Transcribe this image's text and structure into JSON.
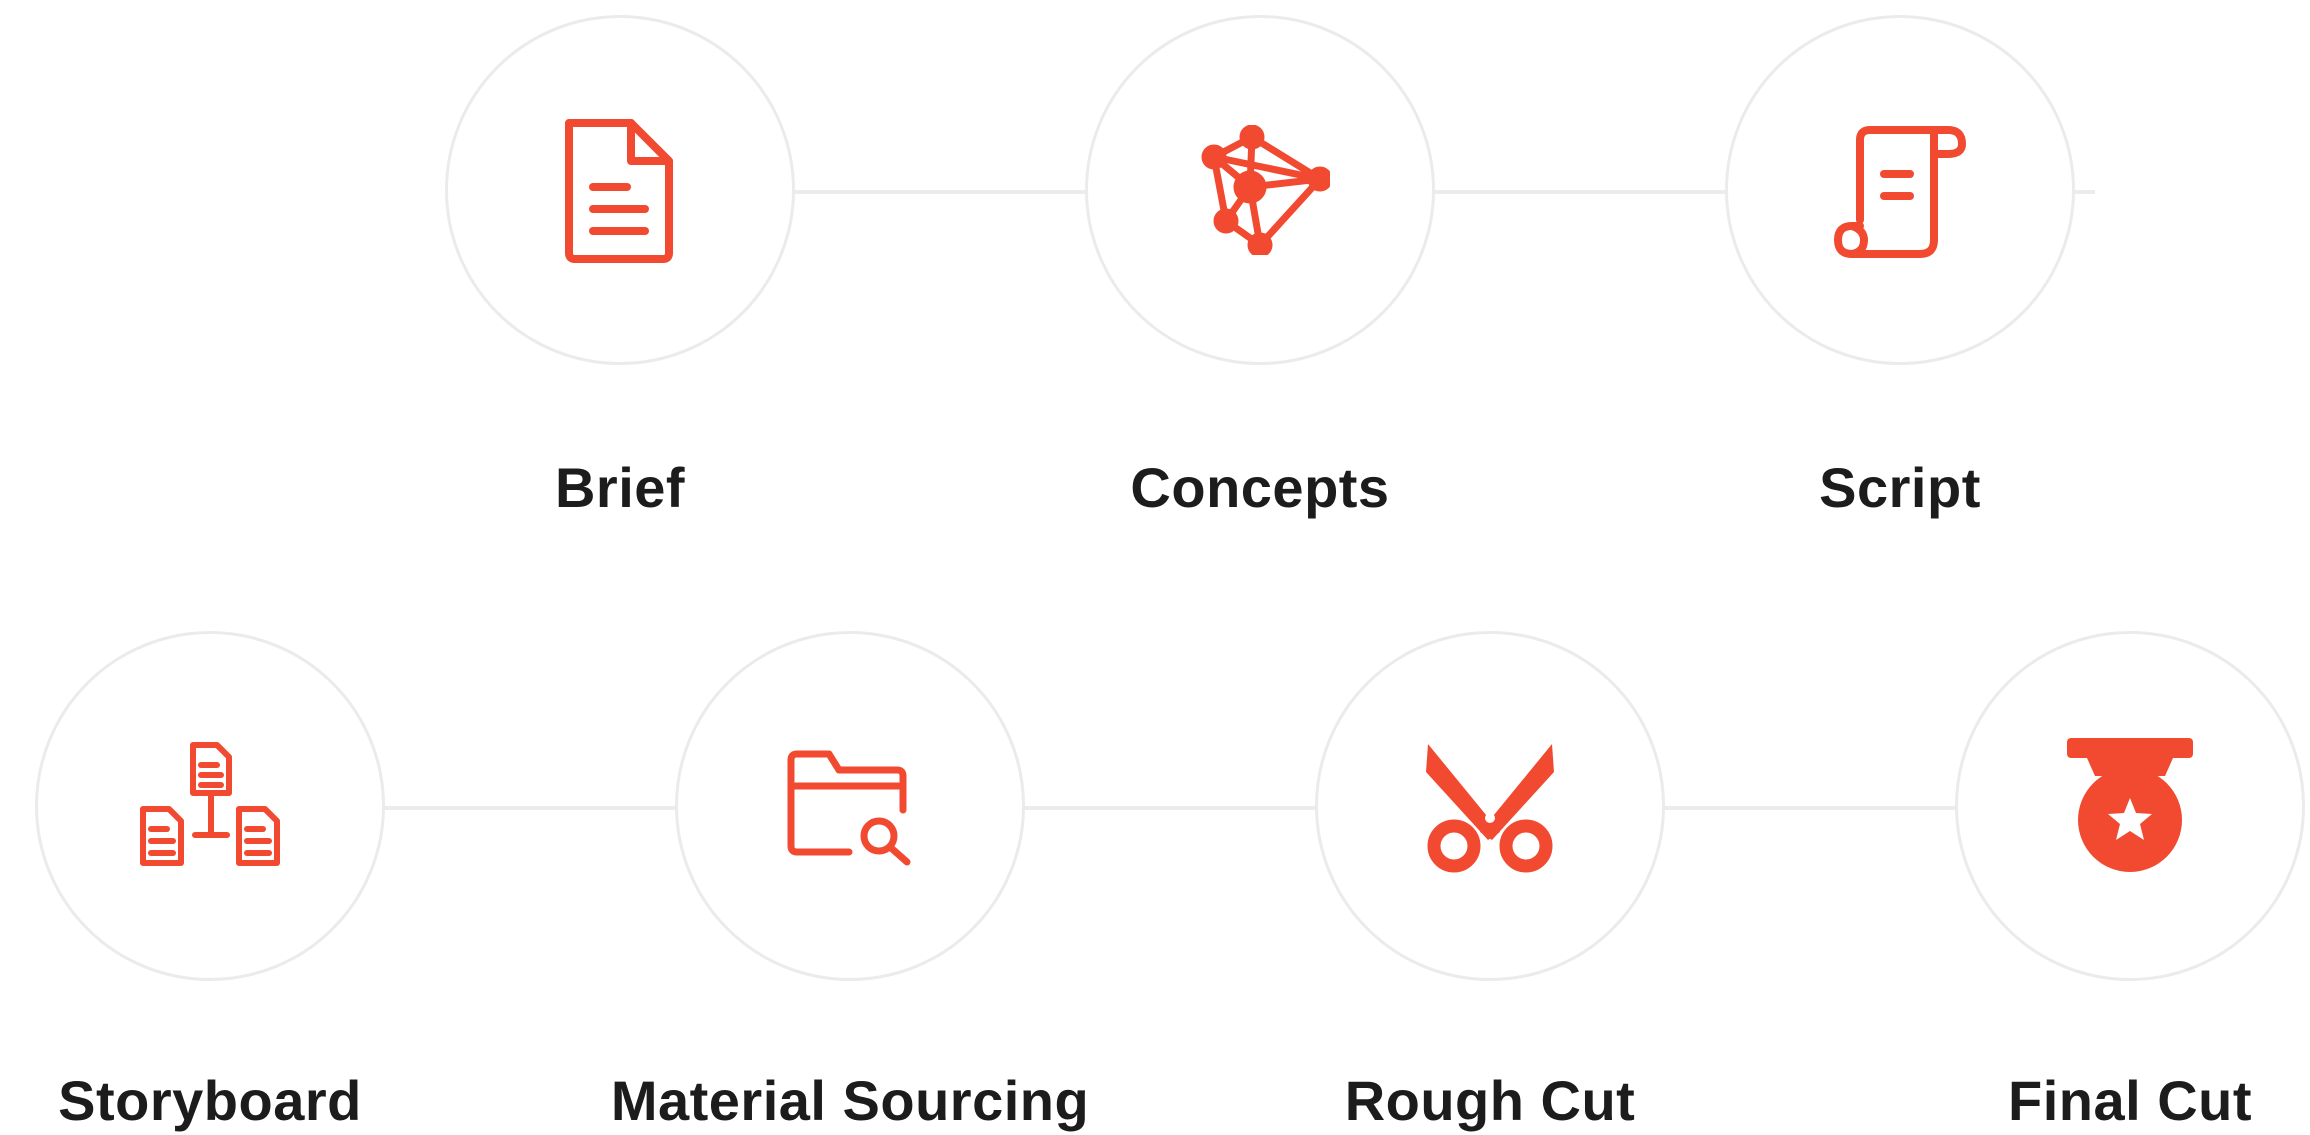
{
  "accent_color": "#f24a30",
  "steps": [
    {
      "label": "Brief",
      "icon": "document-icon"
    },
    {
      "label": "Concepts",
      "icon": "network-icon"
    },
    {
      "label": "Script",
      "icon": "scroll-icon"
    },
    {
      "label": "Storyboard",
      "icon": "hierarchy-documents-icon"
    },
    {
      "label": "Material Sourcing",
      "icon": "folder-search-icon"
    },
    {
      "label": "Rough Cut",
      "icon": "scissors-icon"
    },
    {
      "label": "Final Cut",
      "icon": "medal-icon"
    }
  ]
}
